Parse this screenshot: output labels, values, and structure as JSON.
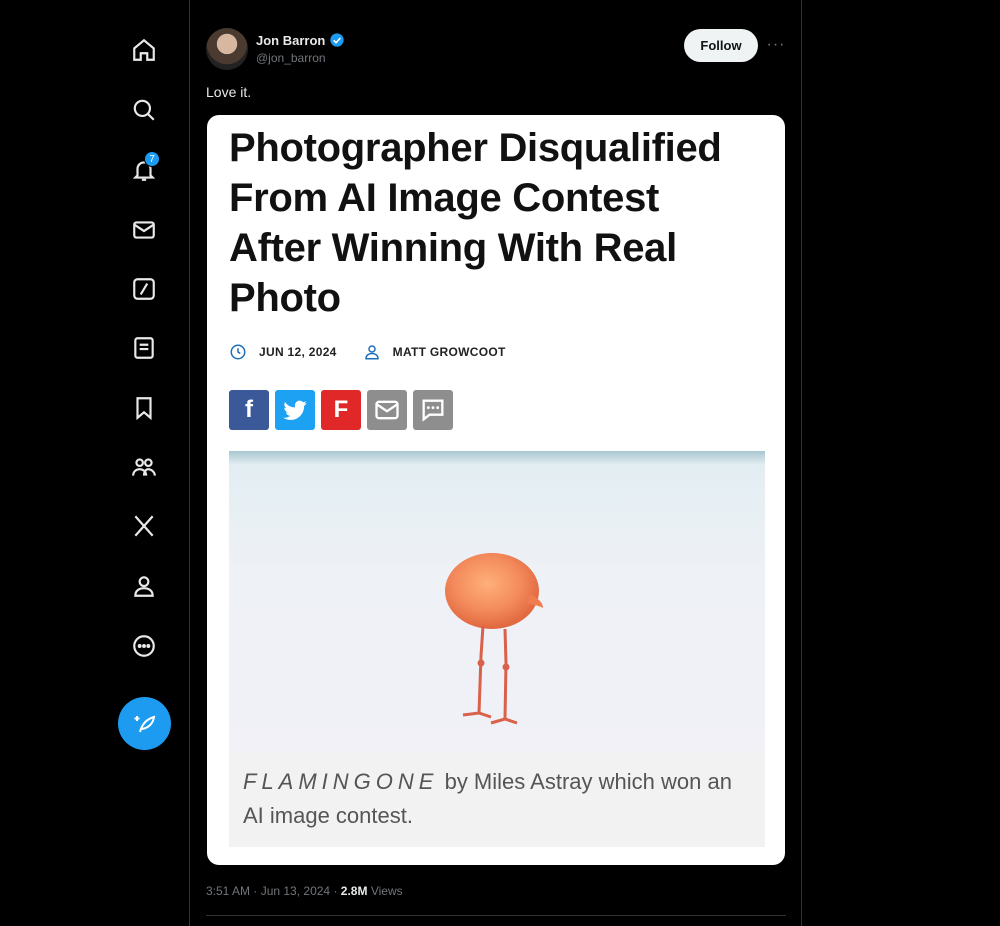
{
  "nav": {
    "items": [
      {
        "name": "home",
        "icon": "home-icon"
      },
      {
        "name": "explore",
        "icon": "search-icon"
      },
      {
        "name": "notifications",
        "icon": "bell-icon",
        "badge": "7"
      },
      {
        "name": "messages",
        "icon": "mail-icon"
      },
      {
        "name": "grok",
        "icon": "slash-square-icon"
      },
      {
        "name": "lists",
        "icon": "list-icon"
      },
      {
        "name": "bookmarks",
        "icon": "bookmark-icon"
      },
      {
        "name": "communities",
        "icon": "people-icon"
      },
      {
        "name": "premium",
        "icon": "x-logo-icon"
      },
      {
        "name": "profile",
        "icon": "person-icon"
      },
      {
        "name": "more",
        "icon": "more-circle-icon"
      }
    ],
    "compose_icon": "feather-plus-icon"
  },
  "tweet": {
    "author_name": "Jon Barron",
    "handle": "@jon_barron",
    "follow_label": "Follow",
    "more_label": "···",
    "text": "Love it.",
    "time": "3:51 AM",
    "date": "Jun 13, 2024",
    "views_count": "2.8M",
    "views_label": "Views"
  },
  "article": {
    "headline": "Photographer Disqualified From AI Image Contest After Winning With Real Photo",
    "date": "JUN 12, 2024",
    "author": "MATT GROWCOOT",
    "share": {
      "facebook": "f",
      "flipboard": "F"
    },
    "caption_title": "FLAMINGONE",
    "caption_rest": " by Miles Astray which won an AI image contest."
  },
  "colors": {
    "accent": "#1d9bf0",
    "background": "#000000",
    "facebook": "#3b5998",
    "twitter": "#1da1f2",
    "flipboard": "#e12828"
  }
}
